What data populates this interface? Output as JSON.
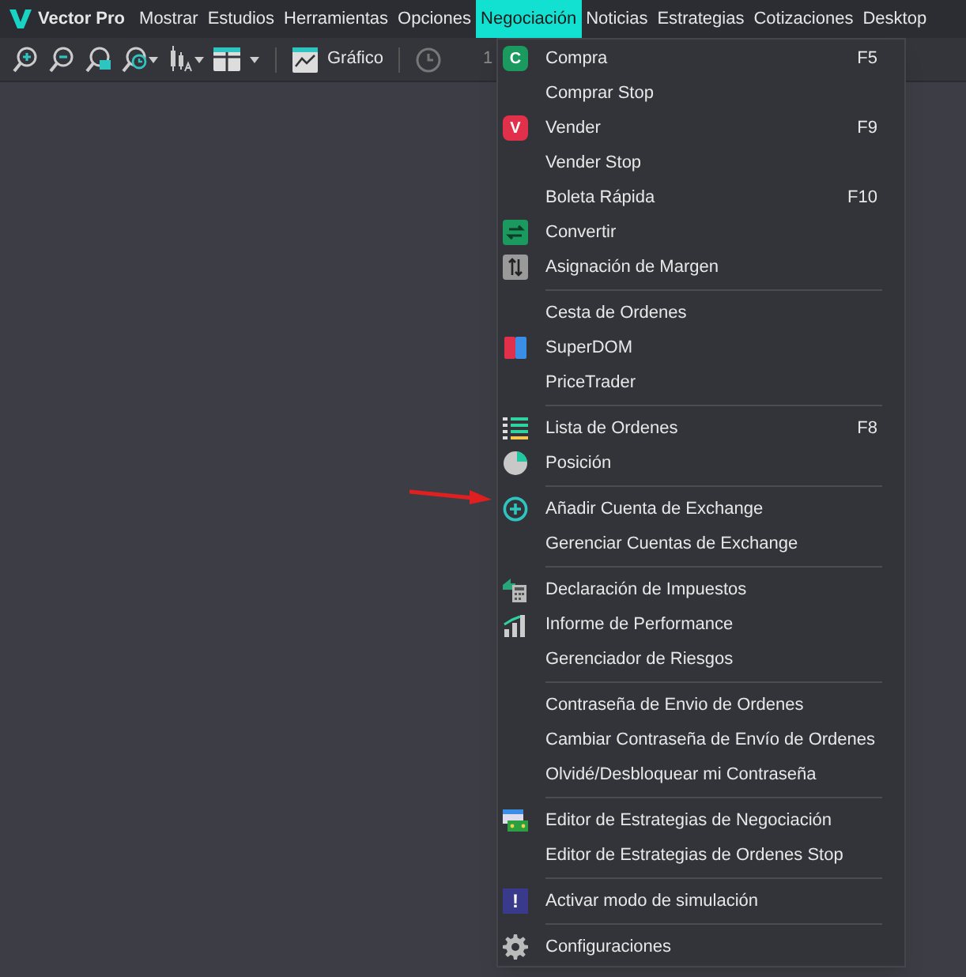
{
  "app": {
    "name": "Vector Pro"
  },
  "menubar": [
    {
      "label": "Mostrar",
      "selected": false
    },
    {
      "label": "Estudios",
      "selected": false
    },
    {
      "label": "Herramientas",
      "selected": false
    },
    {
      "label": "Opciones",
      "selected": false
    },
    {
      "label": "Negociación",
      "selected": true
    },
    {
      "label": "Noticias",
      "selected": false
    },
    {
      "label": "Estrategias",
      "selected": false
    },
    {
      "label": "Cotizaciones",
      "selected": false
    },
    {
      "label": "Desktop",
      "selected": false
    }
  ],
  "toolbar": {
    "chart_button": "Gráfico",
    "interval": "1"
  },
  "menu": [
    {
      "kind": "buy",
      "icon_text": "C",
      "label": "Compra",
      "shortcut": "F5"
    },
    {
      "kind": "plain",
      "label": "Comprar Stop"
    },
    {
      "kind": "sell",
      "icon_text": "V",
      "label": "Vender",
      "shortcut": "F9"
    },
    {
      "kind": "plain",
      "label": "Vender Stop"
    },
    {
      "kind": "plain",
      "label": "Boleta Rápida",
      "shortcut": "F10"
    },
    {
      "kind": "convert",
      "label": "Convertir"
    },
    {
      "kind": "margin",
      "label": "Asignación de Margen"
    },
    {
      "kind": "separator"
    },
    {
      "kind": "plain",
      "label": "Cesta de Ordenes"
    },
    {
      "kind": "superdom",
      "label": "SuperDOM"
    },
    {
      "kind": "plain",
      "label": "PriceTrader"
    },
    {
      "kind": "separator"
    },
    {
      "kind": "list",
      "label": "Lista de Ordenes",
      "shortcut": "F8"
    },
    {
      "kind": "pie",
      "label": "Posición"
    },
    {
      "kind": "separator"
    },
    {
      "kind": "plus",
      "label": "Añadir Cuenta de Exchange"
    },
    {
      "kind": "plain",
      "label": "Gerenciar Cuentas de Exchange"
    },
    {
      "kind": "separator"
    },
    {
      "kind": "tax",
      "label": "Declaración de Impuestos"
    },
    {
      "kind": "perf",
      "label": "Informe de Performance"
    },
    {
      "kind": "plain",
      "label": "Gerenciador de Riesgos"
    },
    {
      "kind": "separator"
    },
    {
      "kind": "plain",
      "label": "Contraseña de Envio de Ordenes"
    },
    {
      "kind": "plain",
      "label": "Cambiar Contraseña de Envío de Ordenes"
    },
    {
      "kind": "plain",
      "label": "Olvidé/Desbloquear mi Contraseña"
    },
    {
      "kind": "separator"
    },
    {
      "kind": "strategy",
      "label": "Editor de Estrategias de Negociación"
    },
    {
      "kind": "plain",
      "label": "Editor de Estrategias de Ordenes Stop"
    },
    {
      "kind": "separator"
    },
    {
      "kind": "alert",
      "icon_text": "!",
      "label": "Activar modo de simulación"
    },
    {
      "kind": "separator"
    },
    {
      "kind": "gear",
      "label": "Configuraciones"
    }
  ]
}
